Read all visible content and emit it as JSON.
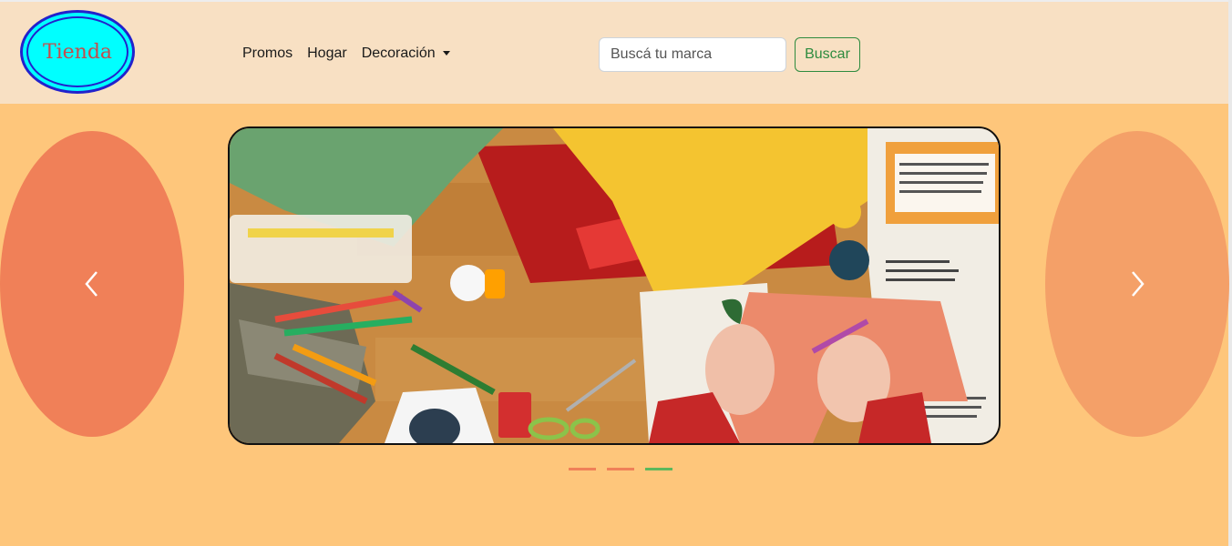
{
  "logo": {
    "text": "Tienda"
  },
  "nav": {
    "links": [
      {
        "label": "Promos"
      },
      {
        "label": "Hogar"
      },
      {
        "label": "Decoración",
        "dropdown": true
      }
    ]
  },
  "search": {
    "placeholder": "Buscá tu marca",
    "value": "",
    "button_label": "Buscar"
  },
  "carousel": {
    "prev_icon": "chevron-left-icon",
    "next_icon": "chevron-right-icon",
    "active_index": 2,
    "indicator_count": 3,
    "colors": {
      "prev": "#f08058",
      "next": "#f4a068",
      "indicator": "#f08058",
      "indicator_active": "#5cb85c"
    },
    "slide_image": "craft-supplies-photo"
  },
  "colors": {
    "navbar": "#f8e0c3",
    "page": "#fec67b",
    "accent": "#2e8b3e"
  }
}
